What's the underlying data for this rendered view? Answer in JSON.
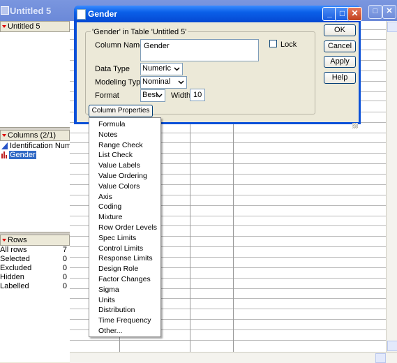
{
  "window": {
    "title": "Untitled 5"
  },
  "left": {
    "table_label": "Untitled 5",
    "columns_header": "Columns (2/1)",
    "columns": [
      {
        "name": "Identification Numb",
        "icon": "continuous-icon"
      },
      {
        "name": "Gender",
        "icon": "nominal-icon",
        "selected": true
      }
    ],
    "rows_header": "Rows",
    "rows": [
      {
        "label": "All rows",
        "value": "7"
      },
      {
        "label": "Selected",
        "value": "0"
      },
      {
        "label": "Excluded",
        "value": "0"
      },
      {
        "label": "Hidden",
        "value": "0"
      },
      {
        "label": "Labelled",
        "value": "0"
      }
    ]
  },
  "dialog": {
    "title": "Gender",
    "group_label": "'Gender' in Table 'Untitled 5'",
    "column_name_label": "Column Name",
    "column_name_value": "Gender",
    "lock_label": "Lock",
    "data_type_label": "Data Type",
    "data_type_value": "Numeric",
    "modeling_type_label": "Modeling Type",
    "modeling_type_value": "Nominal",
    "format_label": "Format",
    "format_value": "Best",
    "width_label": "Width",
    "width_value": "10",
    "column_properties_label": "Column Properties",
    "buttons": {
      "ok": "OK",
      "cancel": "Cancel",
      "apply": "Apply",
      "help": "Help"
    }
  },
  "menu": {
    "items": [
      "Formula",
      "Notes",
      "Range Check",
      "List Check",
      "Value Labels",
      "Value Ordering",
      "Value Colors",
      "Axis",
      "Coding",
      "Mixture",
      "Row Order Levels",
      "Spec Limits",
      "Control Limits",
      "Response Limits",
      "Design Role",
      "Factor Changes",
      "Sigma",
      "Units",
      "Distribution",
      "Time Frequency",
      "Other..."
    ]
  },
  "colors": {
    "title_blue": "#0548d2",
    "close_red": "#c0411f",
    "face": "#ece9d8"
  }
}
